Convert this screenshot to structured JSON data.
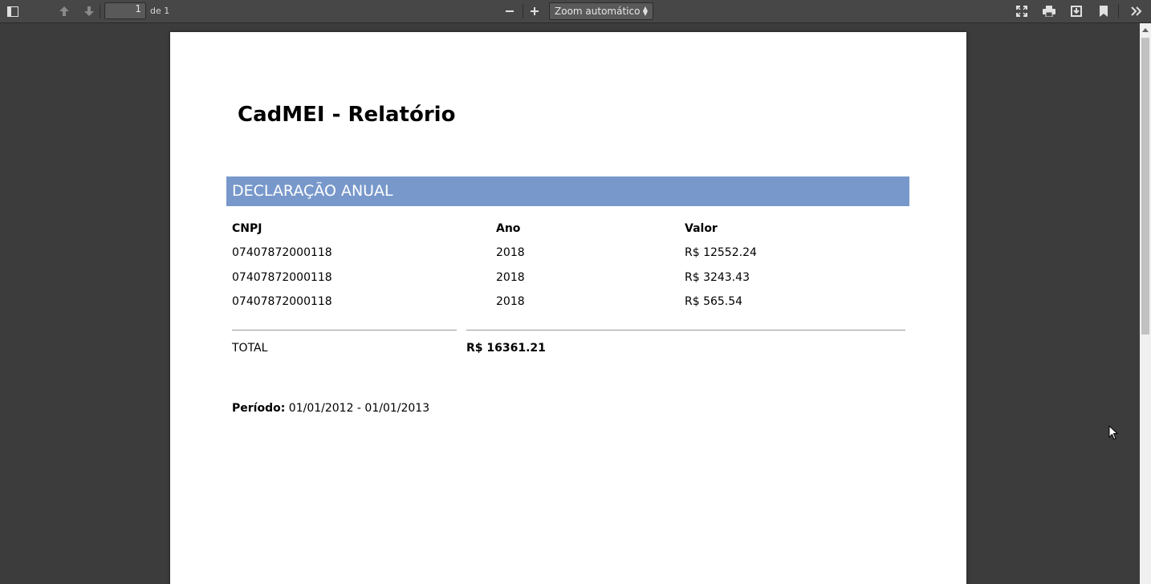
{
  "toolbar": {
    "page_number": "1",
    "page_count": "de 1",
    "zoom": "Zoom automático"
  },
  "document": {
    "title": "CadMEI - Relatório",
    "section": "DECLARAÇÃO ANUAL",
    "columns": [
      "CNPJ",
      "Ano",
      "Valor"
    ],
    "rows": [
      {
        "cnpj": "07407872000118",
        "ano": "2018",
        "valor": "R$ 12552.24"
      },
      {
        "cnpj": "07407872000118",
        "ano": "2018",
        "valor": "R$ 3243.43"
      },
      {
        "cnpj": "07407872000118",
        "ano": "2018",
        "valor": "R$ 565.54"
      }
    ],
    "total_label": "TOTAL",
    "total_value": "R$ 16361.21",
    "period_label": "Período:",
    "period_value": "01/01/2012 - 01/01/2013"
  },
  "colors": {
    "section_bar": "#7898cb",
    "toolbar": "#474747",
    "viewer_bg": "#3c3c3c"
  }
}
